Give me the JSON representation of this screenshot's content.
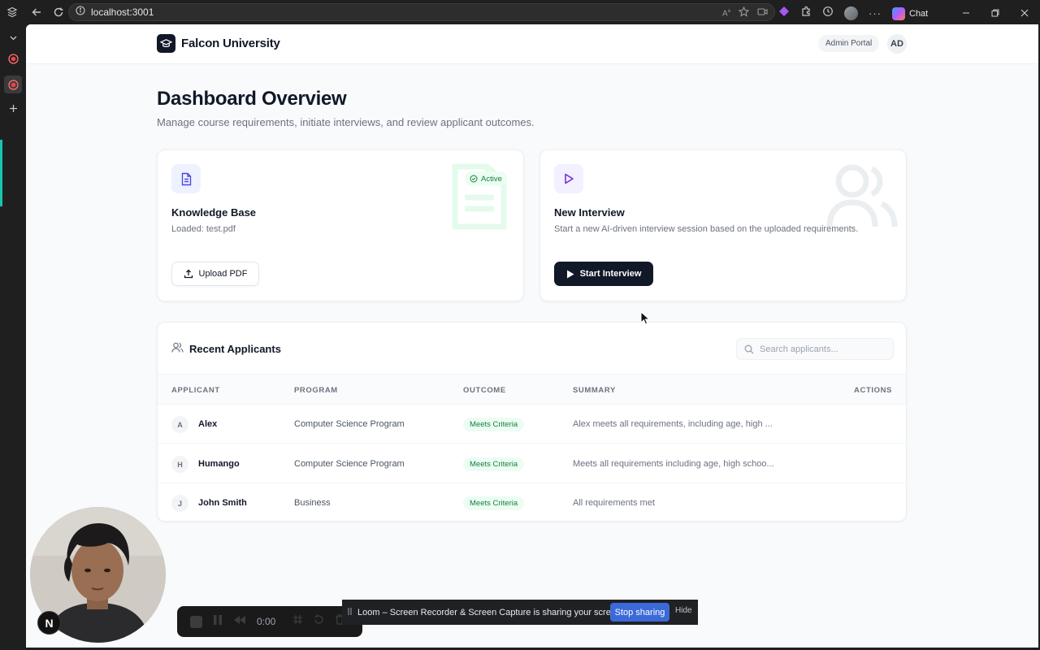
{
  "browser": {
    "url": "localhost:3001",
    "chat_label": "Chat"
  },
  "header": {
    "brand": "Falcon University",
    "admin_label": "Admin Portal",
    "user_initials": "AD"
  },
  "page": {
    "title": "Dashboard Overview",
    "subtitle": "Manage course requirements, initiate interviews, and review applicant outcomes."
  },
  "knowledge_base": {
    "title": "Knowledge Base",
    "status": "Loaded: test.pdf",
    "badge": "Active",
    "button": "Upload PDF"
  },
  "new_interview": {
    "title": "New Interview",
    "description": "Start a new AI-driven interview session based on the uploaded requirements.",
    "button": "Start Interview"
  },
  "applicants": {
    "title": "Recent Applicants",
    "search_placeholder": "Search applicants...",
    "columns": [
      "APPLICANT",
      "PROGRAM",
      "OUTCOME",
      "SUMMARY",
      "ACTIONS"
    ],
    "rows": [
      {
        "initial": "A",
        "name": "Alex",
        "program": "Computer Science Program",
        "outcome": "Meets Criteria",
        "summary": "Alex meets all requirements, including age, high ..."
      },
      {
        "initial": "H",
        "name": "Humango",
        "program": "Computer Science Program",
        "outcome": "Meets Criteria",
        "summary": "Meets all requirements including age, high schoo..."
      },
      {
        "initial": "J",
        "name": "John Smith",
        "program": "Business",
        "outcome": "Meets Criteria",
        "summary": "All requirements met"
      }
    ]
  },
  "recorder": {
    "time": "0:00",
    "share_message": "Loom – Screen Recorder & Screen Capture is sharing your screen.",
    "stop_label": "Stop sharing",
    "hide_label": "Hide",
    "badge": "N"
  },
  "colors": {
    "primary_dark": "#111827",
    "success_text": "#15803d",
    "success_bg": "#ecfdf3",
    "share_button": "#3b6ad8",
    "accent_teal": "#17c3b2"
  }
}
